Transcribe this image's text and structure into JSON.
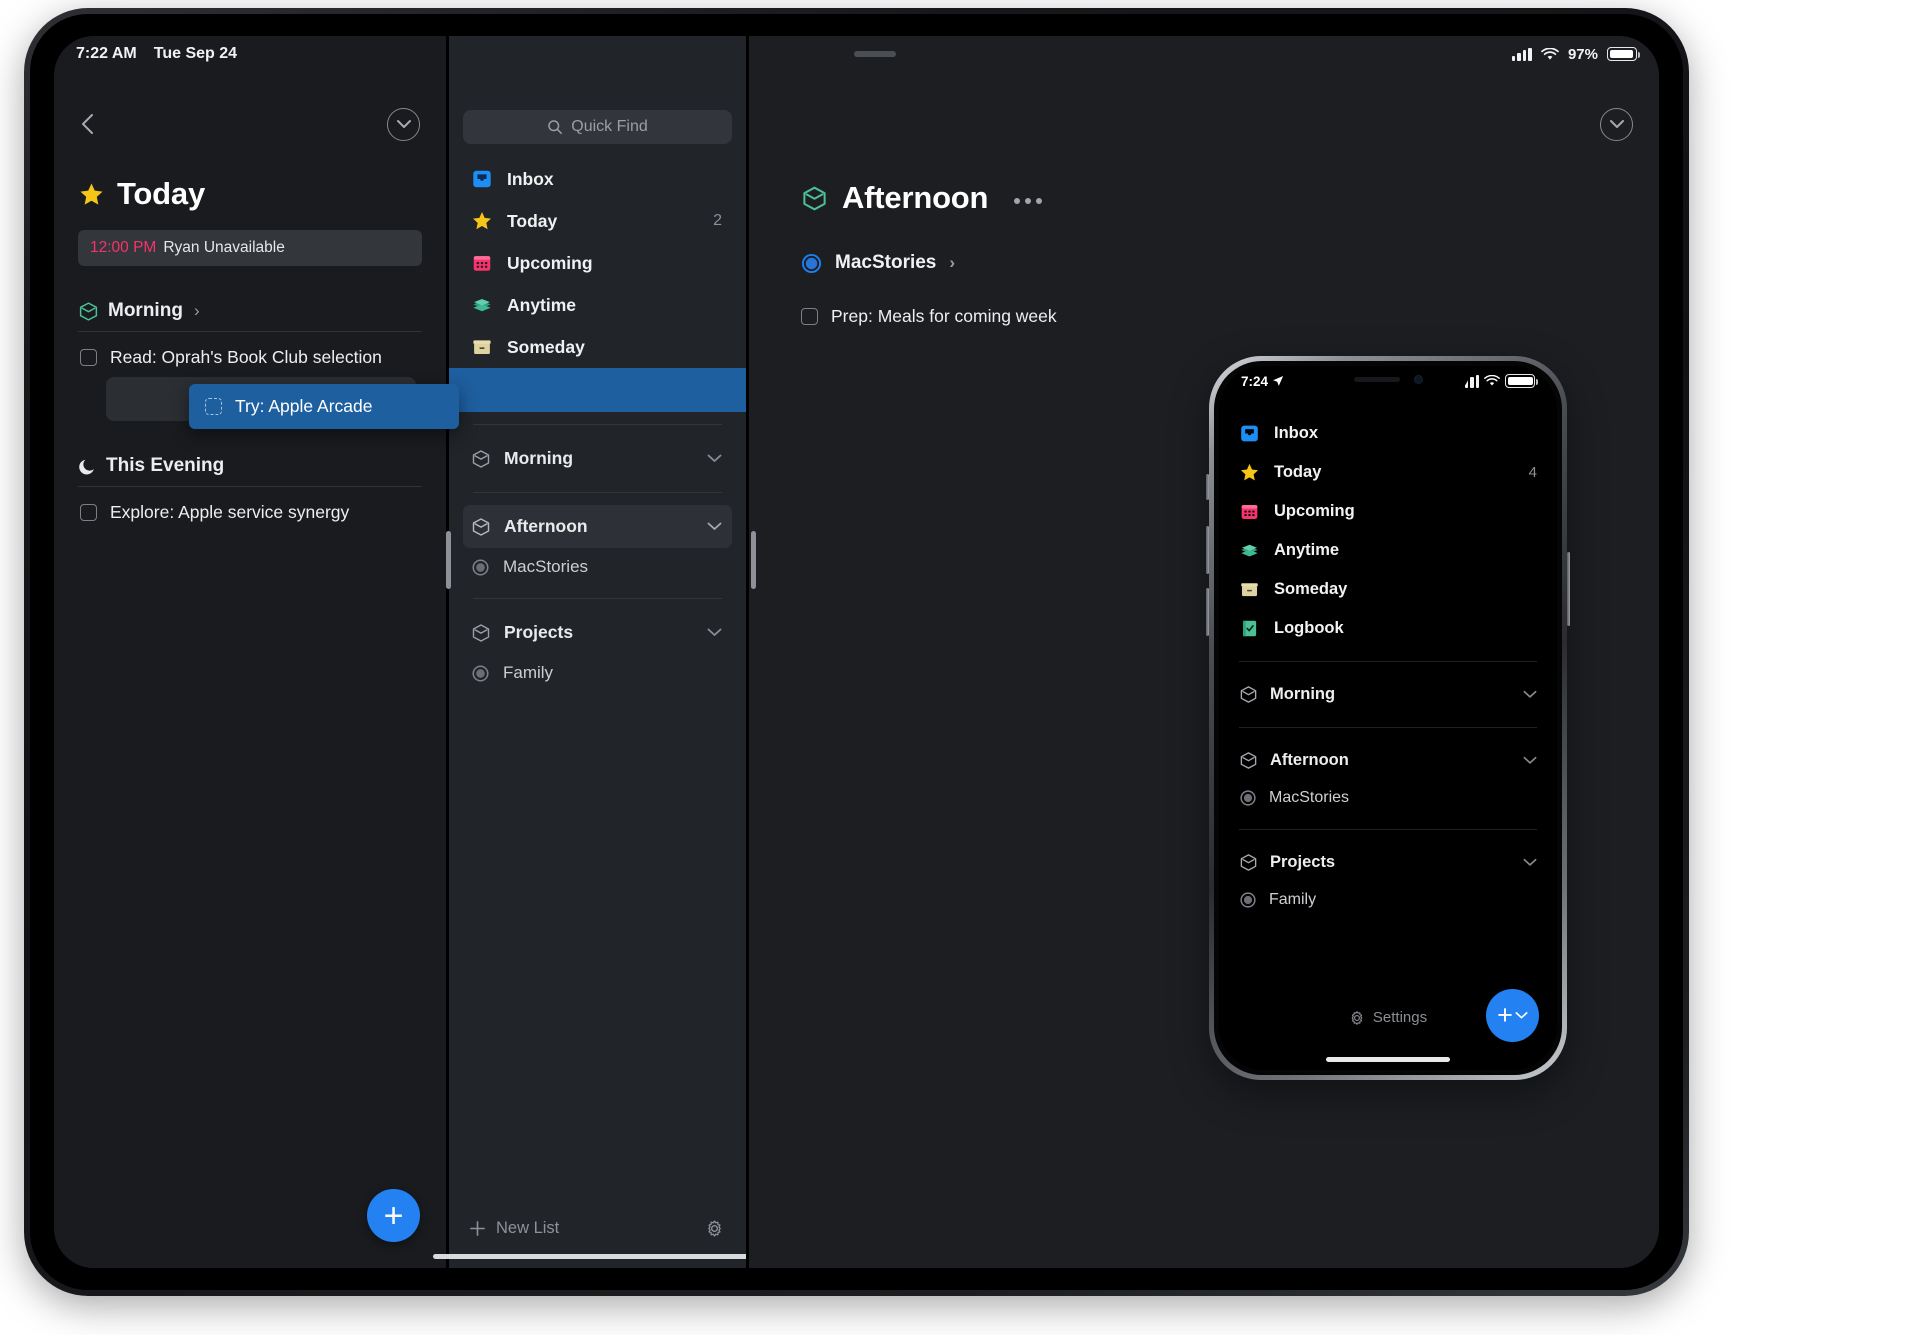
{
  "ipad": {
    "status_bar": {
      "time": "7:22 AM",
      "date": "Tue Sep 24",
      "battery_percent": "97%"
    },
    "today_pane": {
      "title": "Today",
      "title_icon": "star-icon",
      "back_icon": "chevron-left-icon",
      "collapse_icon": "chevron-down-circle-icon",
      "calendar_event": {
        "time": "12:00 PM",
        "label": "Ryan Unavailable"
      },
      "sections": [
        {
          "label": "Morning",
          "icon": "heading-cube-icon",
          "chevron": "›",
          "tasks": [
            {
              "label": "Read: Oprah's Book Club selection"
            }
          ]
        },
        {
          "label": "This Evening",
          "icon": "moon-icon",
          "tasks": [
            {
              "label": "Explore: Apple service synergy"
            }
          ]
        }
      ],
      "dragging_task": {
        "label": "Try: Apple Arcade"
      },
      "add_button_label": "+"
    },
    "sidebar": {
      "quick_find": {
        "placeholder": "Quick Find",
        "icon": "search-icon"
      },
      "items": [
        {
          "label": "Inbox",
          "icon": "inbox-icon",
          "count": ""
        },
        {
          "label": "Today",
          "icon": "star-icon",
          "count": "2"
        },
        {
          "label": "Upcoming",
          "icon": "calendar-icon",
          "count": ""
        },
        {
          "label": "Anytime",
          "icon": "layers-icon",
          "count": ""
        },
        {
          "label": "Someday",
          "icon": "box-icon",
          "count": ""
        }
      ],
      "groups": [
        {
          "label": "Morning",
          "icon": "heading-cube-icon",
          "chevron": "chevron-down-icon",
          "selected": false,
          "children": []
        },
        {
          "label": "Afternoon",
          "icon": "heading-cube-icon",
          "chevron": "chevron-down-icon",
          "selected": true,
          "children": [
            {
              "label": "MacStories",
              "icon": "project-circle-icon"
            }
          ]
        },
        {
          "label": "Projects",
          "icon": "heading-cube-icon",
          "chevron": "chevron-down-icon",
          "selected": false,
          "children": [
            {
              "label": "Family",
              "icon": "project-circle-icon"
            }
          ]
        }
      ],
      "new_list_label": "New List",
      "settings_icon": "gear-icon"
    },
    "detail": {
      "title": "Afternoon",
      "title_icon": "heading-cube-icon",
      "more_icon": "ellipsis-icon",
      "collapse_icon": "chevron-down-circle-icon",
      "project": {
        "label": "MacStories",
        "icon": "project-circle-filled-icon",
        "chevron": "›"
      },
      "tasks": [
        {
          "label": "Prep: Meals for coming week"
        }
      ]
    }
  },
  "iphone": {
    "status_bar": {
      "time": "7:24",
      "location_icon": "location-arrow-icon"
    },
    "items": [
      {
        "label": "Inbox",
        "icon": "inbox-icon",
        "count": ""
      },
      {
        "label": "Today",
        "icon": "star-icon",
        "count": "4"
      },
      {
        "label": "Upcoming",
        "icon": "calendar-icon",
        "count": ""
      },
      {
        "label": "Anytime",
        "icon": "layers-icon",
        "count": ""
      },
      {
        "label": "Someday",
        "icon": "box-icon",
        "count": ""
      },
      {
        "label": "Logbook",
        "icon": "logbook-icon",
        "count": ""
      }
    ],
    "groups": [
      {
        "label": "Morning",
        "icon": "heading-cube-icon",
        "children": []
      },
      {
        "label": "Afternoon",
        "icon": "heading-cube-icon",
        "children": [
          {
            "label": "MacStories",
            "icon": "project-circle-icon"
          }
        ]
      },
      {
        "label": "Projects",
        "icon": "heading-cube-icon",
        "children": [
          {
            "label": "Family",
            "icon": "project-circle-icon"
          }
        ]
      }
    ],
    "settings_label": "Settings",
    "settings_icon": "gear-icon",
    "add_button_label": "+"
  },
  "colors": {
    "accent_blue": "#2381f2",
    "drag_blue": "#1e5fa0",
    "event_pink": "#f5336d",
    "green": "#4cbf95",
    "star_yellow": "#f5c518"
  }
}
